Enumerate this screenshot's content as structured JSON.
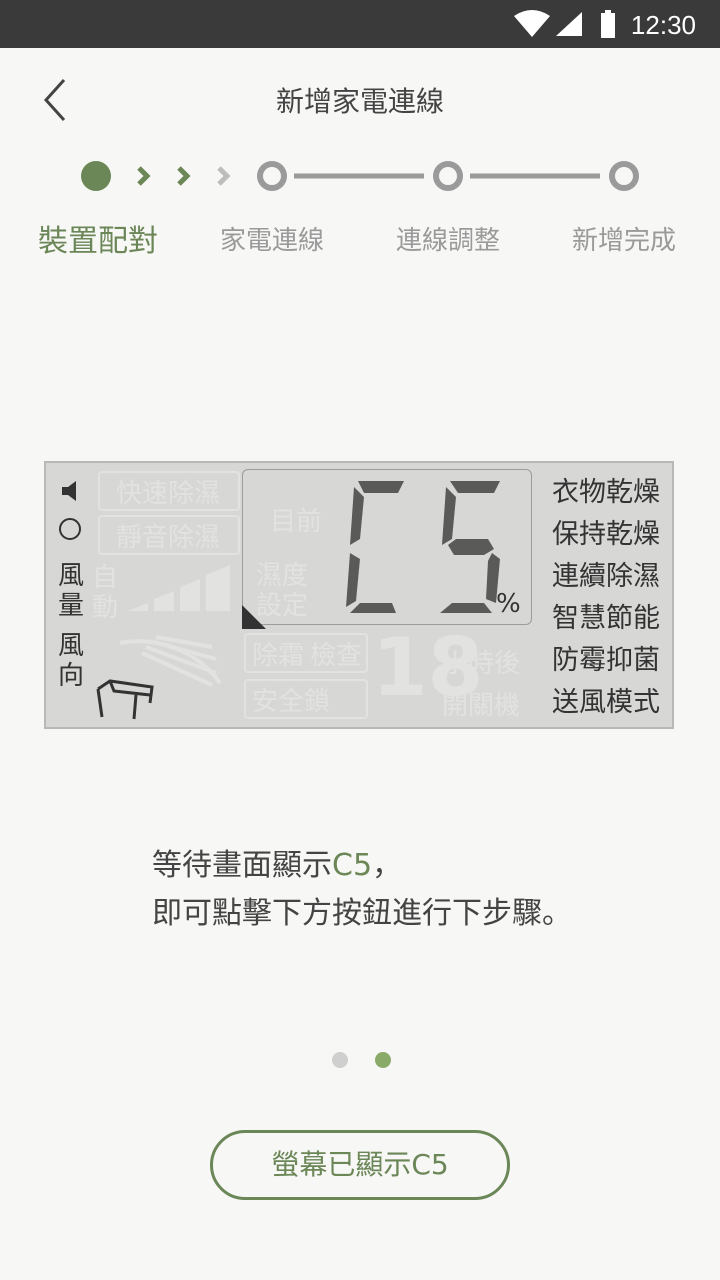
{
  "statusbar": {
    "time": "12:30"
  },
  "header": {
    "title": "新增家電連線"
  },
  "steps": [
    "裝置配對",
    "家電連線",
    "連線調整",
    "新增完成"
  ],
  "lcd": {
    "left_labels": [
      "風",
      "量",
      "風",
      "向"
    ],
    "ghost_left": [
      "快速除濕",
      "靜音除濕",
      "自",
      "動"
    ],
    "ghost_center": [
      "目前",
      "濕度",
      "設定",
      "除霜",
      "檢查",
      "安全鎖",
      "小時後",
      "開關機",
      "18"
    ],
    "code": "C5",
    "percent": "%",
    "modes": [
      "衣物乾燥",
      "保持乾燥",
      "連續除濕",
      "智慧節能",
      "防霉抑菌",
      "送風模式"
    ]
  },
  "instruction": {
    "line1_prefix": "等待畫面顯示",
    "line1_code": "C5",
    "line1_suffix": "，",
    "line2": "即可點擊下方按鈕進行下步驟。"
  },
  "pager": {
    "total": 2,
    "active": 2
  },
  "button": {
    "label": "螢幕已顯示C5"
  },
  "colors": {
    "accent": "#6b8657",
    "inactive": "#9a9a9a",
    "lcd_bg": "#d7d8d6"
  }
}
